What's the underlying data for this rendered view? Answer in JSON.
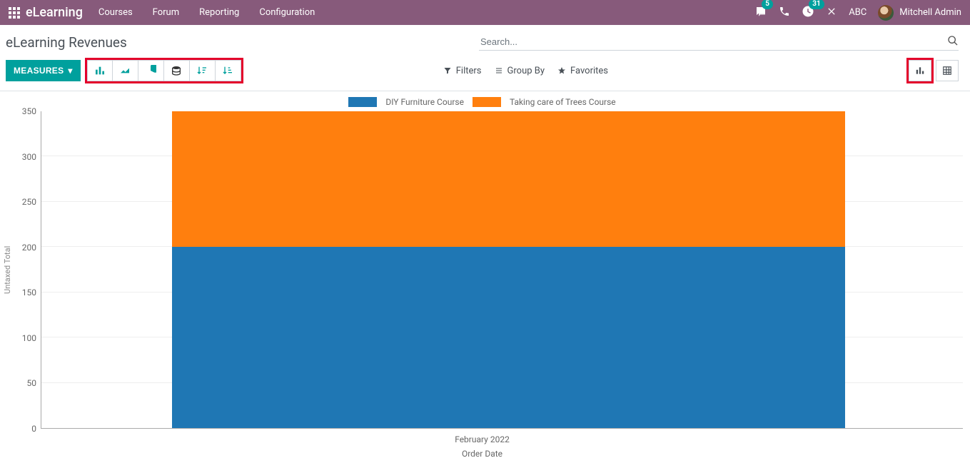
{
  "nav": {
    "brand": "eLearning",
    "menu": [
      "Courses",
      "Forum",
      "Reporting",
      "Configuration"
    ],
    "chat_badge": "5",
    "activity_badge": "31",
    "company": "ABC",
    "user_name": "Mitchell Admin"
  },
  "header": {
    "title": "eLearning Revenues",
    "search_placeholder": "Search...",
    "measures_label": "MEASURES",
    "filters_label": "Filters",
    "groupby_label": "Group By",
    "favorites_label": "Favorites"
  },
  "chart_data": {
    "type": "bar",
    "stacked": true,
    "title": "",
    "xlabel": "Order Date",
    "ylabel": "Untaxed Total",
    "ylim": [
      0,
      350
    ],
    "yticks": [
      0,
      50,
      100,
      150,
      200,
      250,
      300,
      350
    ],
    "categories": [
      "February 2022"
    ],
    "series": [
      {
        "name": "DIY Furniture Course",
        "color": "#1F77B4",
        "values": [
          200
        ]
      },
      {
        "name": "Taking care of Trees Course",
        "color": "#FF7F0E",
        "values": [
          150
        ]
      }
    ]
  }
}
